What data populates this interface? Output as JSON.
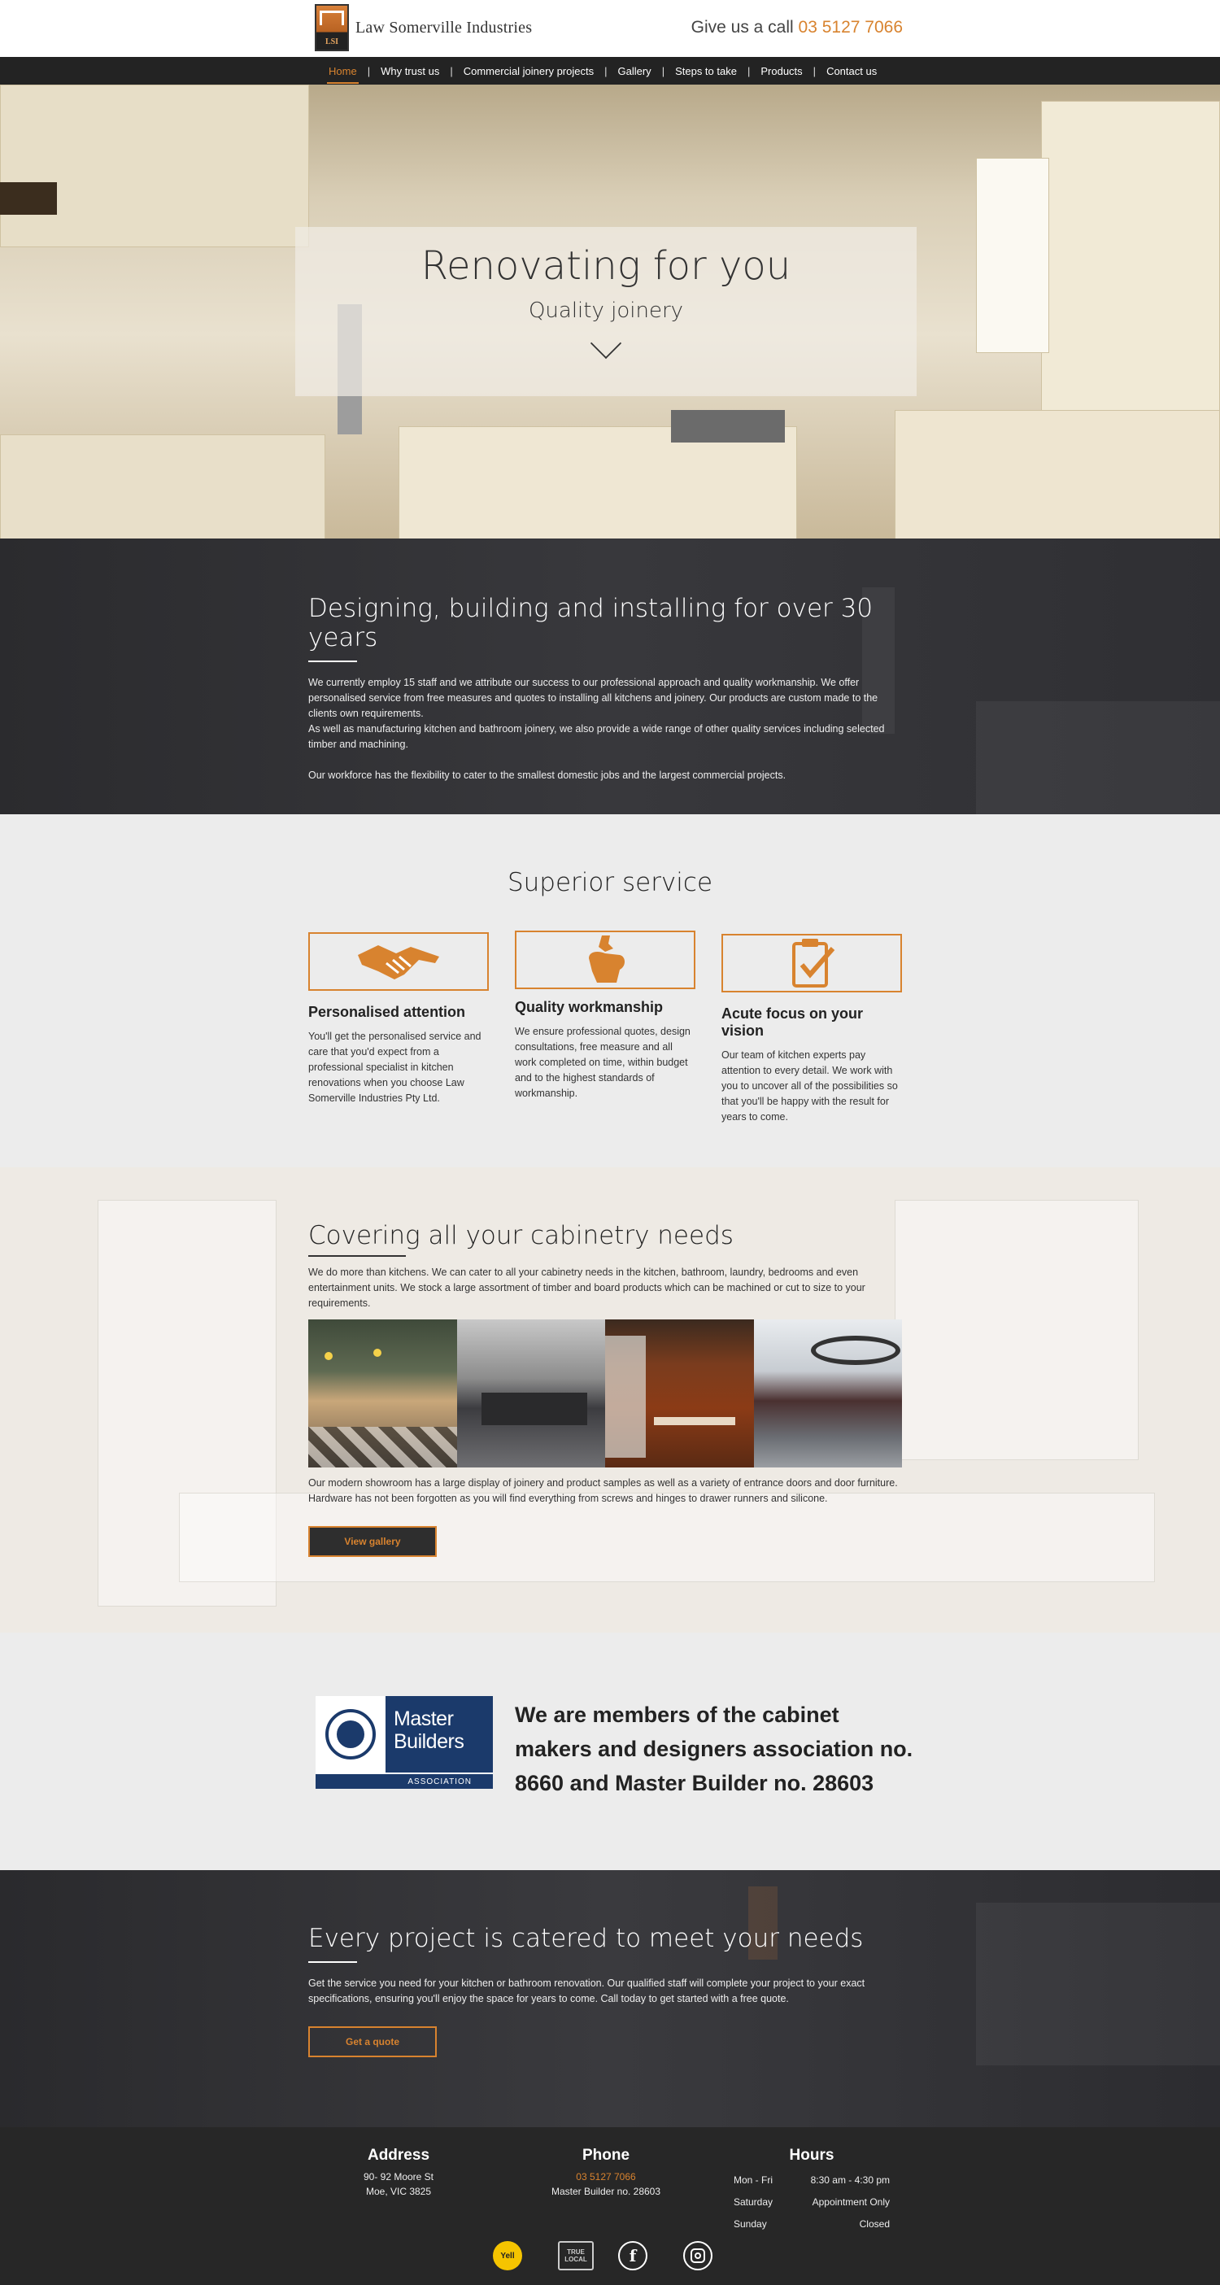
{
  "header": {
    "logo_text": "Law Somerville Industries",
    "logo_mark": "LSI",
    "call_prefix": "Give us a call",
    "phone": "03 5127 7066"
  },
  "nav": {
    "items": [
      "Home",
      "Why trust us",
      "Commercial joinery projects",
      "Gallery",
      "Steps to take",
      "Products",
      "Contact us"
    ],
    "active": "Home"
  },
  "hero": {
    "title": "Renovating for you",
    "subtitle": "Quality joinery",
    "scroll_icon": "chevron-down-icon"
  },
  "about": {
    "heading": "Designing, building and installing for over 30 years",
    "paragraph1": "We currently employ 15 staff and we attribute our success to our professional approach and quality workmanship. We offer personalised service from free measures and quotes to installing all kitchens and joinery. Our products are custom made to the clients own requirements.",
    "paragraph2": "As well as manufacturing kitchen and bathroom joinery, we also provide a wide range of other quality services including selected timber and machining.",
    "paragraph3": "Our workforce has the flexibility to cater to the smallest domestic jobs and the largest commercial projects."
  },
  "superior": {
    "heading": "Superior service",
    "cards": [
      {
        "icon": "handshake-icon",
        "title": "Personalised attention",
        "text": "You'll get the personalised service and care that you'd expect from a professional specialist in kitchen renovations when you choose Law Somerville Industries Pty Ltd."
      },
      {
        "icon": "wrench-hand-icon",
        "title": "Quality workmanship",
        "text": "We ensure professional quotes, design consultations, free measure and all work completed on time, within budget and to the highest standards of workmanship."
      },
      {
        "icon": "clipboard-check-icon",
        "title": "Acute focus on your vision",
        "text": "Our team of kitchen experts pay attention to every detail. We work with you to uncover all of the possibilities so that you'll be happy with the result for years to come."
      }
    ]
  },
  "cabinetry": {
    "heading": "Covering all your cabinetry needs",
    "intro": "We do more than kitchens. We can cater to all your cabinetry needs in the kitchen, bathroom, laundry, bedrooms and even entertainment units. We stock a large assortment of timber and board products which can be machined or cut to size to your requirements.",
    "photos": [
      "cafe-interior-photo",
      "kitchen-island-photo",
      "bathroom-vanity-photo",
      "office-interior-photo"
    ],
    "showroom": "Our modern showroom has a large display of joinery and product samples as well as a variety of entrance doors and door furniture. Hardware has not been forgotten as you will find everything from screws and hinges to drawer runners and silicone.",
    "button": "View gallery"
  },
  "members": {
    "logo_line1": "Master",
    "logo_line2": "Builders",
    "logo_bar": "ASSOCIATION",
    "text": "We are members of the cabinet makers and designers association no. 8660 and Master Builder no. 28603"
  },
  "project": {
    "heading": "Every project is catered to meet your needs",
    "text": "Get the service you need for your kitchen or bathroom renovation. Our qualified staff will complete your project to your exact specifications, ensuring you'll enjoy the space for years to come. Call today to get started with a free quote.",
    "button": "Get a quote"
  },
  "footer": {
    "address_title": "Address",
    "address_line1": "90- 92 Moore St",
    "address_line2": "Moe, VIC 3825",
    "phone_title": "Phone",
    "phone": "03 5127 7066",
    "builder": "Master Builder no. 28603",
    "hours_title": "Hours",
    "hours": [
      {
        "day": "Mon - Fri",
        "time": "8:30 am - 4:30 pm"
      },
      {
        "day": "Saturday",
        "time": "Appointment Only"
      },
      {
        "day": "Sunday",
        "time": "Closed"
      }
    ],
    "socials": [
      "yellow-pages-icon",
      "true-local-icon",
      "facebook-icon",
      "instagram-icon"
    ],
    "yellow_label": "Yell",
    "truelocal_label": "TRUE LOCAL"
  },
  "colors": {
    "accent": "#d8832f",
    "dark": "#232323",
    "mb_blue": "#1b3a6b"
  }
}
